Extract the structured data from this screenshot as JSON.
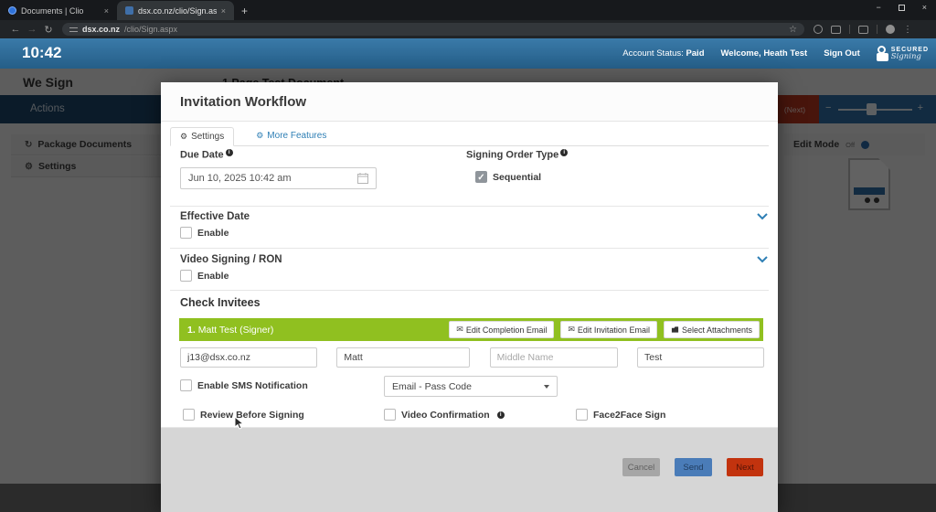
{
  "browser": {
    "tab1": "Documents | Clio",
    "tab2": "dsx.co.nz/clio/Sign.aspx",
    "url_domain": "dsx.co.nz",
    "url_path": "/clio/Sign.aspx"
  },
  "header": {
    "time": "10:42",
    "account_status_label": "Account Status:",
    "account_status_value": "Paid",
    "welcome": "Welcome, Heath Test",
    "sign_out": "Sign Out",
    "brand_top": "SECURED",
    "brand_bottom": "Signing"
  },
  "page": {
    "section_title": "We Sign",
    "document_title": "1 Page Test Document",
    "actions_label": "Actions",
    "next_fragment": "(Next)",
    "sidebar_item1": "Package Documents",
    "sidebar_item2": "Settings",
    "edit_mode_label": "Edit Mode",
    "edit_mode_state": "Off"
  },
  "modal": {
    "title": "Invitation Workflow",
    "tab_settings": "Settings",
    "tab_more": "More Features",
    "due_date_label": "Due Date",
    "due_date_value": "Jun 10, 2025 10:42 am",
    "signing_order_label": "Signing Order Type",
    "sequential_label": "Sequential",
    "effective_date_title": "Effective Date",
    "effective_date_enable": "Enable",
    "video_signing_title": "Video Signing / RON",
    "video_signing_enable": "Enable",
    "invitees_heading": "Check Invitees",
    "invitee_number": "1.",
    "invitee_name": "Matt Test (Signer)",
    "btn_completion": "Edit Completion Email",
    "btn_invitation": "Edit Invitation Email",
    "btn_attachments": "Select Attachments",
    "email_value": "j13@dsx.co.nz",
    "first_name_value": "Matt",
    "middle_name_placeholder": "Middle Name",
    "last_name_value": "Test",
    "sms_label": "Enable SMS Notification",
    "auth_method": "Email - Pass Code",
    "opt_review": "Review Before Signing",
    "opt_video": "Video Confirmation",
    "opt_f2f": "Face2Face Sign",
    "cancel": "Cancel",
    "send": "Send",
    "next": "Next"
  },
  "icons": {
    "gear": "⚙",
    "envelope": "✉",
    "check": "✓",
    "star": "☆",
    "back": "←",
    "forward": "→",
    "reload": "↻",
    "menu_dots": "⋮",
    "close": "×",
    "plus": "+",
    "minus": "−",
    "info": "i",
    "sync": "↻"
  },
  "colors": {
    "header_blue": "#2e6da4",
    "invitee_green": "#90c020",
    "send_blue": "#4a7cb8",
    "next_red": "#c2330e"
  }
}
